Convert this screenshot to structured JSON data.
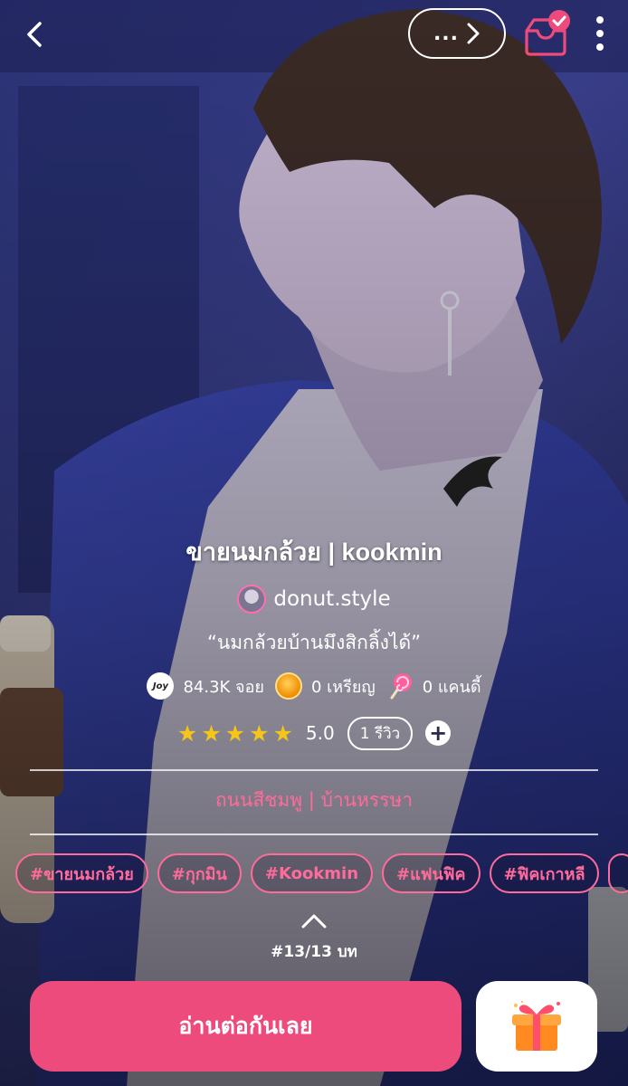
{
  "colors": {
    "accent": "#ee4b7d",
    "tag_pink": "#ff6b9b",
    "star": "#f5c518",
    "background": "#2a2f6e"
  },
  "header": {
    "more_chapters_label": "...",
    "icons": [
      "chevron-left-icon",
      "chevron-right-icon",
      "inbox-check-icon",
      "more-vertical-icon"
    ]
  },
  "story": {
    "title": "ขายนมกล้วย | kookmin",
    "author": "donut.style",
    "tagline": "“นมกล้วยบ้านมึงสิกลิ้งได้”",
    "stats": {
      "joy": "84.3K จอย",
      "coins": "0 เหรียญ",
      "candy": "0 แคนดี้"
    },
    "rating": {
      "stars": 5,
      "value": "5.0",
      "reviews_label": "1 รีวิว"
    },
    "category": {
      "primary": "ถนนสีชมพู",
      "separator": "|",
      "secondary": "บ้านหรรษา"
    },
    "tags": [
      "#ขายนมกล้วย",
      "#กุกมิน",
      "#Kookmin",
      "#แฟนฟิค",
      "#ฟิคเกาหลี"
    ],
    "chapter_count": "#13/13 บท"
  },
  "actions": {
    "read_label": "อ่านต่อกันเลย",
    "gift_icon": "gift-icon"
  }
}
